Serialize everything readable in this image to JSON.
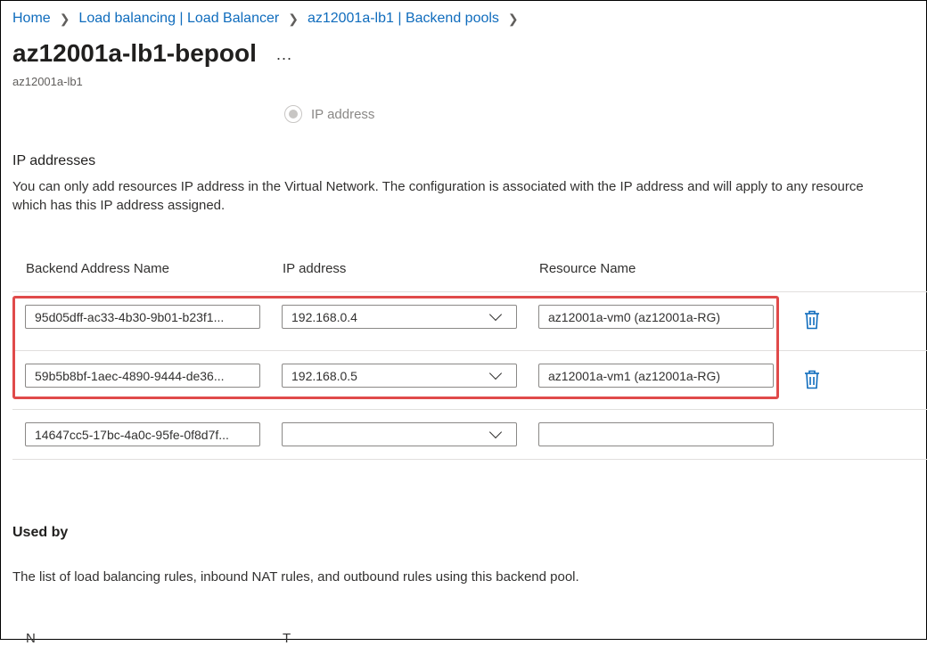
{
  "breadcrumb": [
    "Home",
    "Load balancing | Load Balancer",
    "az12001a-lb1 | Backend pools"
  ],
  "page": {
    "title": "az12001a-lb1-bepool",
    "more_label": "...",
    "subtitle": "az12001a-lb1"
  },
  "radio": {
    "label": "IP address"
  },
  "ip_section": {
    "title": "IP addresses",
    "description": "You can only add resources IP address in the Virtual Network. The configuration is associated with the IP address and will apply to any resource which has this IP address assigned."
  },
  "table": {
    "headers": [
      "Backend Address Name",
      "IP address",
      "Resource Name"
    ],
    "rows": [
      {
        "name": "95d05dff-ac33-4b30-9b01-b23f1...",
        "ip": "192.168.0.4",
        "resource": "az12001a-vm0 (az12001a-RG)",
        "delete": true
      },
      {
        "name": "59b5b8bf-1aec-4890-9444-de36...",
        "ip": "192.168.0.5",
        "resource": "az12001a-vm1 (az12001a-RG)",
        "delete": true
      },
      {
        "name": "14647cc5-17bc-4a0c-95fe-0f8d7f...",
        "ip": "",
        "resource": "",
        "delete": false
      }
    ]
  },
  "used_by": {
    "title": "Used by",
    "description": "The list of load balancing rules, inbound NAT rules, and outbound rules using this backend pool.",
    "columns": [
      "N",
      "T"
    ]
  },
  "colors": {
    "link": "#0f6cbd",
    "highlight": "#e04a4a",
    "trash": "#0f6cbd"
  }
}
